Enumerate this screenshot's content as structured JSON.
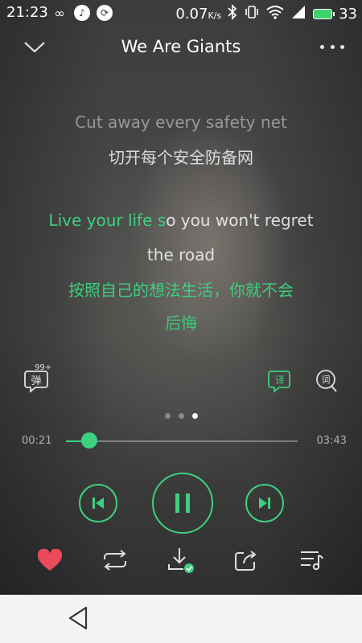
{
  "status_bar": {
    "time": "21:23",
    "network_speed": "0.07",
    "network_unit": "K/s",
    "battery_level": "33",
    "icons": [
      "infinity-icon",
      "app-notification-icon",
      "sync-icon",
      "bluetooth-icon",
      "vibrate-icon",
      "wifi-icon",
      "signal-icon",
      "battery-icon"
    ]
  },
  "header": {
    "title": "We Are Giants"
  },
  "lyrics": {
    "line1": "Cut away every safety net",
    "line2": "切开每个安全防备网",
    "line3_played": "Live your life s",
    "line3_rest": "o you won't regret",
    "line4": "the road",
    "line5": "按照自己的想法生活，你就不会",
    "line6": "后悔"
  },
  "tools": {
    "danmaku_label": "弹",
    "danmaku_count": "99+",
    "translate_label": "译",
    "lyrics_label": "词"
  },
  "pager": {
    "count": 3,
    "active": 3
  },
  "progress": {
    "elapsed": "00:21",
    "total": "03:43",
    "fraction": 0.1
  },
  "colors": {
    "accent": "#3dd07e",
    "heart": "#e94b5b"
  },
  "actions": [
    "heart-icon",
    "repeat-icon",
    "download-icon",
    "share-icon",
    "playlist-icon"
  ]
}
